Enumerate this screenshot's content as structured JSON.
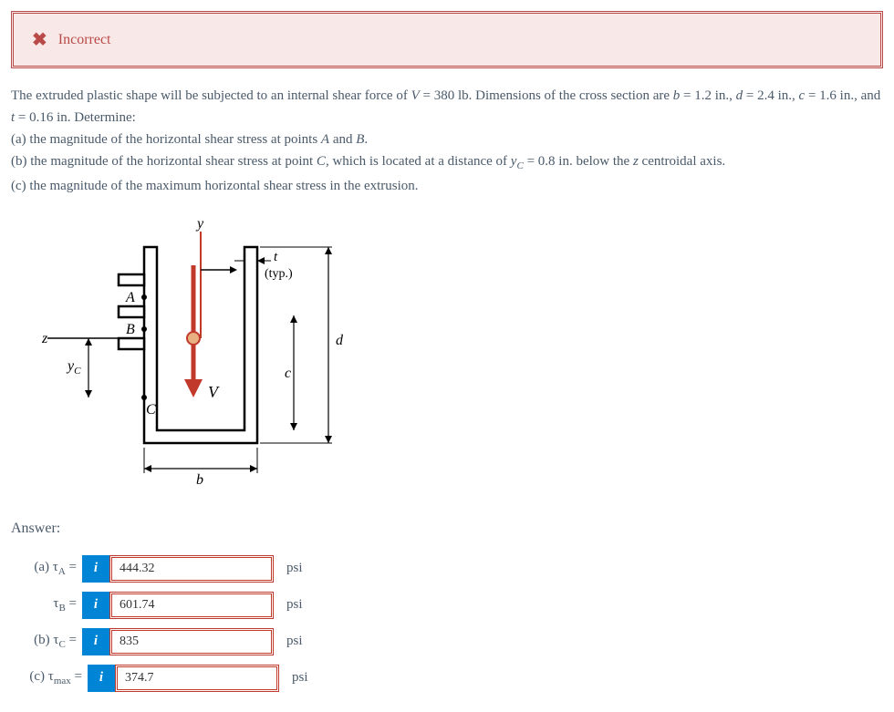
{
  "status": {
    "icon_label": "✖",
    "text": "Incorrect"
  },
  "problem": {
    "line1_pre": "The extruded plastic shape will be subjected to an internal shear force of ",
    "line1_v": "V",
    "line1_vval": " = 380 lb. Dimensions of the cross section are ",
    "line1_b": "b",
    "line1_bval": " = 1.2 in., ",
    "line1_d": "d",
    "line1_dval": " = 2.4 in., ",
    "line1_c": "c",
    "line1_cval": " = 1.6 in., and ",
    "line1_t": "t",
    "line1_tval": " = 0.16 in.  Determine:",
    "part_a": "(a) the magnitude of the horizontal shear stress at points ",
    "part_a_A": "A",
    "part_a_and": " and ",
    "part_a_B": "B",
    "part_a_end": ".",
    "part_b": "(b) the magnitude of the horizontal shear stress at point ",
    "part_b_C": "C",
    "part_b_mid": ", which is located at a distance of ",
    "part_b_yc": "y",
    "part_b_ycsub": "C",
    "part_b_ycval": " = 0.8 in. below the ",
    "part_b_z": "z",
    "part_b_end": " centroidal axis.",
    "part_c": "(c) the magnitude of the maximum horizontal shear stress in the extrusion."
  },
  "figure": {
    "labels": {
      "y": "y",
      "z": "z",
      "A": "A",
      "B": "B",
      "C": "C",
      "V": "V",
      "b": "b",
      "c": "c",
      "d": "d",
      "t": "t",
      "typ": "(typ.)",
      "yc": "y",
      "yc_sub": "C"
    }
  },
  "answer": {
    "title": "Answer:",
    "rows": [
      {
        "prefix": "(a) τ",
        "sub": "A",
        "eq": " =",
        "value": "444.32",
        "unit": "psi"
      },
      {
        "prefix": "τ",
        "sub": "B",
        "eq": " =",
        "value": "601.74",
        "unit": "psi"
      },
      {
        "prefix": "(b) τ",
        "sub": "C",
        "eq": " =",
        "value": "835",
        "unit": "psi"
      },
      {
        "prefix": "(c) τ",
        "sub": "max",
        "eq": " =",
        "value": "374.7",
        "unit": "psi"
      }
    ],
    "info_icon": "i"
  }
}
